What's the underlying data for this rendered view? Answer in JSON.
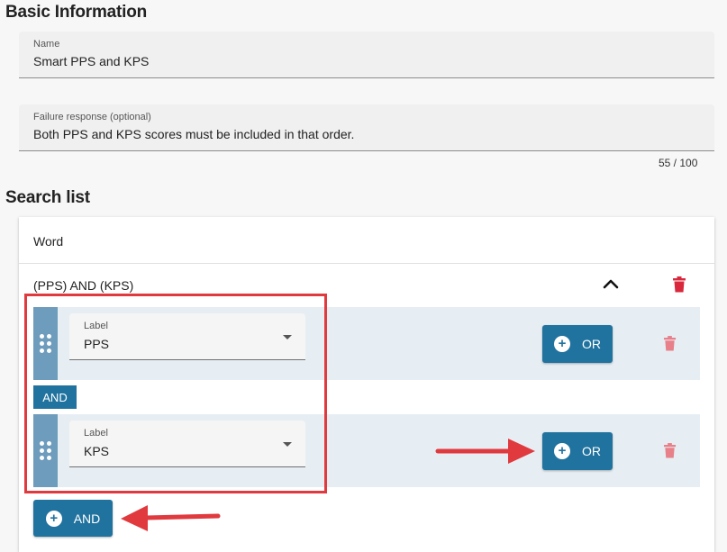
{
  "basic_info": {
    "title": "Basic Information",
    "name_label": "Name",
    "name_value": "Smart PPS and KPS",
    "failure_label": "Failure response (optional)",
    "failure_value": "Both PPS and KPS scores must be included in that order.",
    "counter": "55 / 100"
  },
  "search_list": {
    "title": "Search list",
    "type_label": "Word",
    "group": {
      "expression": "(PPS) AND (KPS)",
      "terms": [
        {
          "field_label": "Label",
          "value": "PPS",
          "or_label": "OR"
        },
        {
          "field_label": "Label",
          "value": "KPS",
          "or_label": "OR"
        }
      ],
      "connector": "AND",
      "add_and_label": "AND"
    }
  },
  "colors": {
    "button_blue": "#21739f",
    "handle_blue": "#6e9cbc",
    "row_bg": "#e6eef4",
    "delete_red_strong": "#d9283c",
    "delete_red_soft": "#e88089",
    "annotation_red": "#e0393e"
  },
  "icons": {
    "collapse": "chevron-up-icon",
    "delete": "trash-icon",
    "drag": "drag-handle-icon",
    "add": "plus-circle-icon"
  }
}
